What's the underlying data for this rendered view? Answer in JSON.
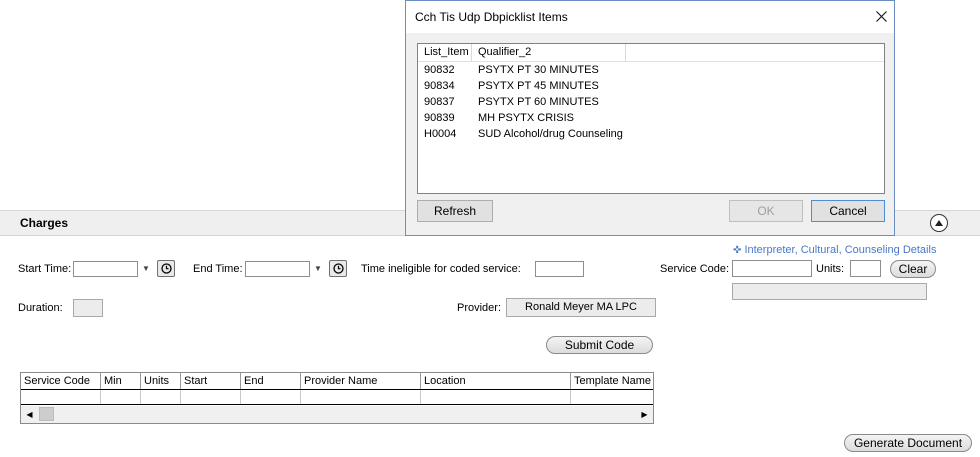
{
  "charges": {
    "title": "Charges",
    "details_link": "Interpreter, Cultural, Counseling Details"
  },
  "form": {
    "start_time_label": "Start Time:",
    "start_time_value": "",
    "end_time_label": "End Time:",
    "end_time_value": "",
    "time_ineligible_label": "Time ineligible for coded service:",
    "time_ineligible_value": "",
    "duration_label": "Duration:",
    "duration_value": "",
    "provider_label": "Provider:",
    "provider_value": "Ronald Meyer MA LPC",
    "service_code_label": "Service Code:",
    "service_code_value": "",
    "units_label": "Units:",
    "units_value": "",
    "clear_label": "Clear",
    "submit_label": "Submit Code",
    "generate_label": "Generate Document"
  },
  "grid": {
    "columns": [
      "Service Code",
      "Min",
      "Units",
      "Start",
      "End",
      "Provider Name",
      "Location",
      "Template Name"
    ]
  },
  "dialog": {
    "title": "Cch Tis Udp Dbpicklist Items",
    "columns": [
      "List_Item",
      "Qualifier_2"
    ],
    "rows": [
      {
        "code": "90832",
        "desc": "PSYTX PT 30 MINUTES"
      },
      {
        "code": "90834",
        "desc": "PSYTX PT 45 MINUTES"
      },
      {
        "code": "90837",
        "desc": "PSYTX PT 60 MINUTES"
      },
      {
        "code": "90839",
        "desc": "MH PSYTX CRISIS"
      },
      {
        "code": "H0004",
        "desc": "SUD Alcohol/drug Counseling"
      }
    ],
    "refresh_label": "Refresh",
    "ok_label": "OK",
    "cancel_label": "Cancel"
  },
  "colors": {
    "link": "#4a78c9",
    "dialog_border": "#6a8ec4"
  }
}
